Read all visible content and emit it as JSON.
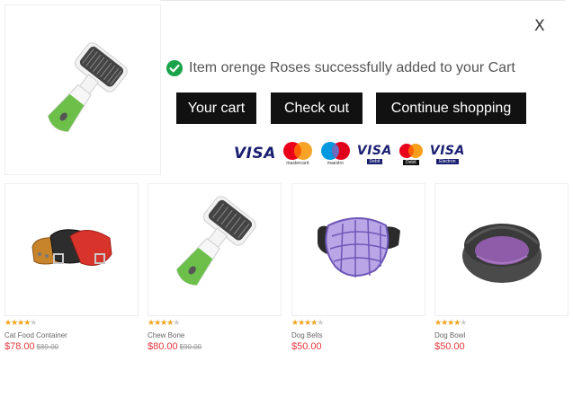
{
  "modal": {
    "close_label": "X",
    "message": "Item orenge Roses successfully added to your Cart",
    "buttons": {
      "your_cart": "Your cart",
      "check_out": "Check out",
      "continue_shopping": "Continue shopping"
    },
    "payment_cards": [
      {
        "name": "VISA",
        "sub": ""
      },
      {
        "name": "mastercard",
        "sub": "mastercard"
      },
      {
        "name": "maestro",
        "sub": "maestro"
      },
      {
        "name": "VISA",
        "sub": "Debit"
      },
      {
        "name": "mastercard",
        "sub": "Debit"
      },
      {
        "name": "VISA",
        "sub": "Electron"
      }
    ]
  },
  "products": [
    {
      "name": "Cat Food Container",
      "price": "$78.00",
      "old_price": "$89.00",
      "rating": 4,
      "image": "dog-collars"
    },
    {
      "name": "Chew Bone",
      "price": "$80.00",
      "old_price": "$90.00",
      "rating": 4,
      "image": "slicker-brush"
    },
    {
      "name": "Dog Belts",
      "price": "$50.00",
      "old_price": "",
      "rating": 4,
      "image": "dog-muzzle"
    },
    {
      "name": "Dog Bowl",
      "price": "$50.00",
      "old_price": "",
      "rating": 4,
      "image": "pet-bed"
    }
  ],
  "colors": {
    "button_bg": "#111111",
    "price": "#e8373d",
    "star": "#f4a21b",
    "success": "#1aa34a",
    "brush_green": "#6cc04a"
  }
}
